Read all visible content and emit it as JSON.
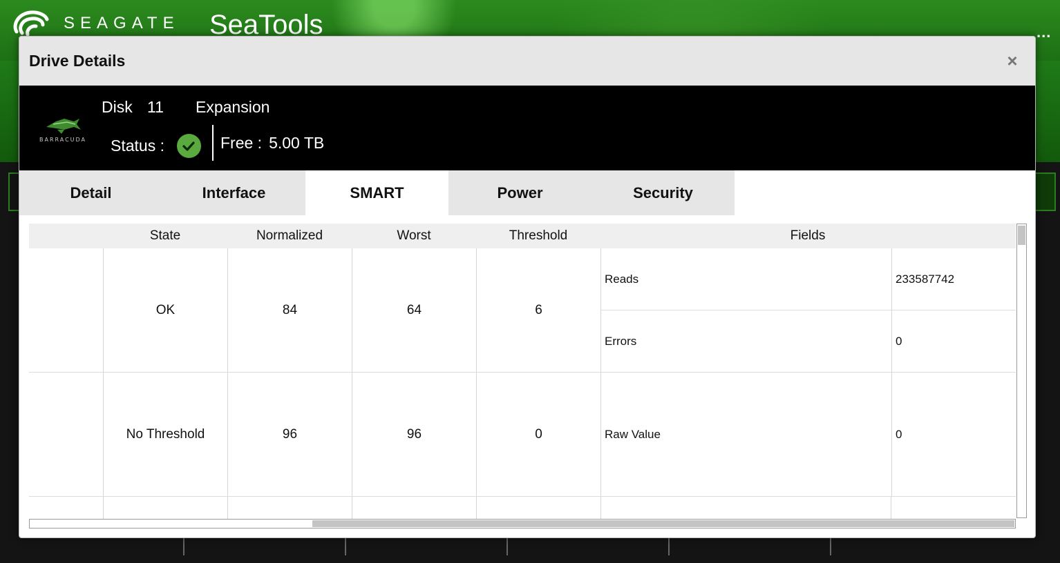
{
  "app": {
    "brand": "SEAGATE",
    "title": "SeaTools",
    "more": "..."
  },
  "modal": {
    "title": "Drive Details",
    "close": "×"
  },
  "drive": {
    "disk_label": "Disk",
    "disk_number": "11",
    "name": "Expansion",
    "logo_text": "BARRACUDA",
    "status_label": "Status :",
    "status_icon": "check-circle-icon",
    "free_label": "Free :",
    "free_value": "5.00 TB"
  },
  "tabs": [
    {
      "label": "Detail",
      "active": false
    },
    {
      "label": "Interface",
      "active": false
    },
    {
      "label": "SMART",
      "active": true
    },
    {
      "label": "Power",
      "active": false
    },
    {
      "label": "Security",
      "active": false
    }
  ],
  "table": {
    "headers": {
      "state": "State",
      "normalized": "Normalized",
      "worst": "Worst",
      "threshold": "Threshold",
      "fields": "Fields"
    },
    "rows": [
      {
        "state": "OK",
        "normalized": "84",
        "worst": "64",
        "threshold": "6",
        "fields": [
          {
            "name": "Reads",
            "value": "233587742"
          },
          {
            "name": "Errors",
            "value": "0"
          }
        ]
      },
      {
        "state": "No Threshold",
        "normalized": "96",
        "worst": "96",
        "threshold": "0",
        "fields": [
          {
            "name": "Raw Value",
            "value": "0"
          }
        ]
      }
    ]
  },
  "colors": {
    "status_ok": "#5aaa3f",
    "brand_green": "#2c8a1e"
  }
}
